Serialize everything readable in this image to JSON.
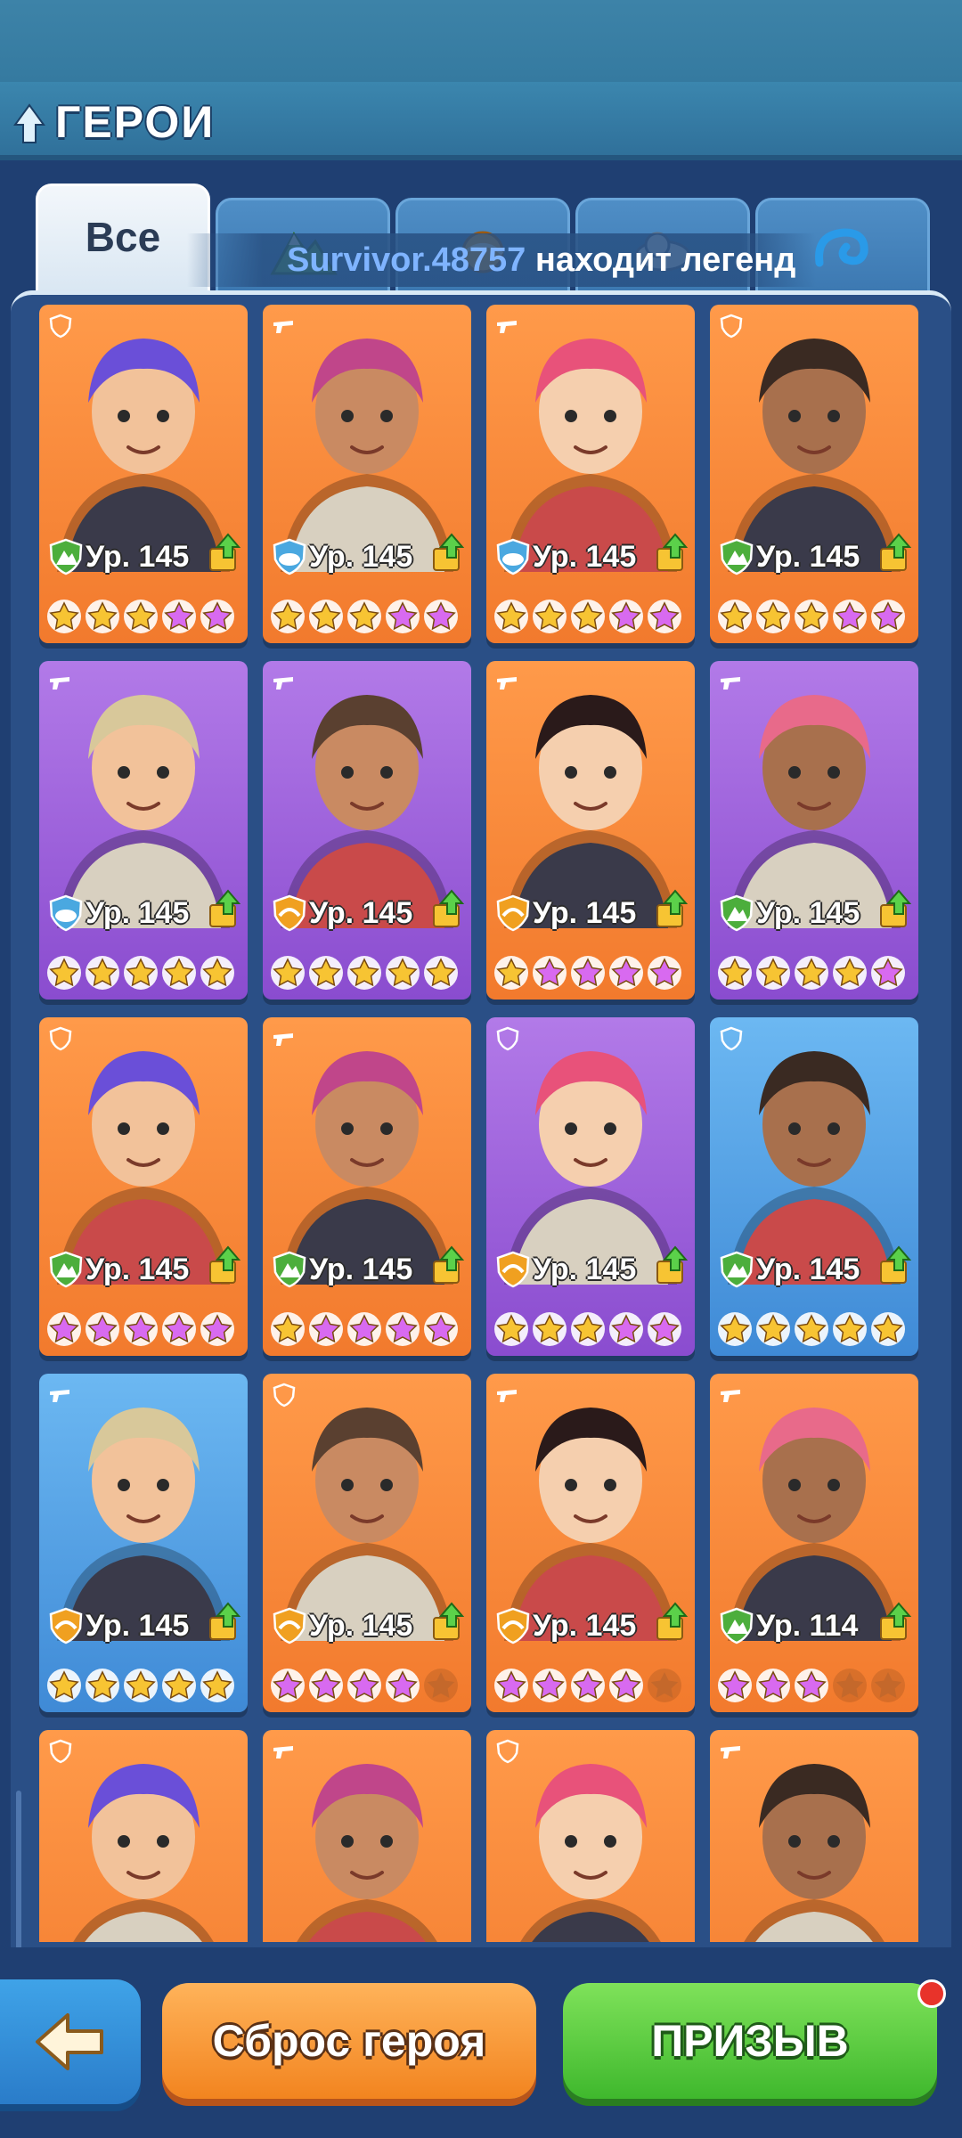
{
  "header": {
    "title": "ГЕРОИ"
  },
  "tabs": [
    {
      "label": "Все",
      "icon": "all",
      "active": true
    },
    {
      "label": "",
      "icon": "mountain-element-icon",
      "active": false
    },
    {
      "label": "",
      "icon": "sun-element-icon",
      "active": false
    },
    {
      "label": "",
      "icon": "cloud-element-icon",
      "active": false
    },
    {
      "label": "",
      "icon": "wave-element-icon",
      "active": false
    }
  ],
  "ticker": {
    "name": "Survivor.48757",
    "message": " находит легенд"
  },
  "heroes": [
    {
      "bg": "orange",
      "role": "shield-icon",
      "element": "mountain",
      "level": "Ур. 145",
      "gold": 3,
      "purple": 2
    },
    {
      "bg": "orange",
      "role": "gun-icon",
      "element": "cloud",
      "level": "Ур. 145",
      "gold": 3,
      "purple": 2
    },
    {
      "bg": "orange",
      "role": "gun-icon",
      "element": "cloud",
      "level": "Ур. 145",
      "gold": 3,
      "purple": 2
    },
    {
      "bg": "orange",
      "role": "shield-icon",
      "element": "mountain",
      "level": "Ур. 145",
      "gold": 3,
      "purple": 2
    },
    {
      "bg": "purple",
      "role": "gun-icon",
      "element": "cloud",
      "level": "Ур. 145",
      "gold": 5,
      "purple": 0
    },
    {
      "bg": "purple",
      "role": "gun-icon",
      "element": "sun",
      "level": "Ур. 145",
      "gold": 5,
      "purple": 0
    },
    {
      "bg": "orange",
      "role": "gun-icon",
      "element": "sun",
      "level": "Ур. 145",
      "gold": 1,
      "purple": 4
    },
    {
      "bg": "purple",
      "role": "gun-icon",
      "element": "mountain",
      "level": "Ур. 145",
      "gold": 4,
      "purple": 1
    },
    {
      "bg": "orange",
      "role": "shield-icon",
      "element": "mountain",
      "level": "Ур. 145",
      "gold": 0,
      "purple": 5
    },
    {
      "bg": "orange",
      "role": "gun-icon",
      "element": "mountain",
      "level": "Ур. 145",
      "gold": 1,
      "purple": 4
    },
    {
      "bg": "purple",
      "role": "shield-icon",
      "element": "sun",
      "level": "Ур. 145",
      "gold": 3,
      "purple": 2
    },
    {
      "bg": "blue",
      "role": "shield-icon",
      "element": "mountain",
      "level": "Ур. 145",
      "gold": 5,
      "purple": 0
    },
    {
      "bg": "blue",
      "role": "gun-icon",
      "element": "sun",
      "level": "Ур. 145",
      "gold": 5,
      "purple": 0
    },
    {
      "bg": "orange",
      "role": "shield-icon",
      "element": "sun",
      "level": "Ур. 145",
      "gold": 0,
      "purple": 4
    },
    {
      "bg": "orange",
      "role": "gun-icon",
      "element": "sun",
      "level": "Ур. 145",
      "gold": 0,
      "purple": 4
    },
    {
      "bg": "orange",
      "role": "gun-icon",
      "element": "mountain",
      "level": "Ур. 114",
      "gold": 0,
      "purple": 3
    },
    {
      "bg": "orange",
      "role": "shield-icon",
      "element": "",
      "level": "",
      "gold": 0,
      "purple": 0
    },
    {
      "bg": "orange",
      "role": "gun-icon",
      "element": "",
      "level": "",
      "gold": 0,
      "purple": 0
    },
    {
      "bg": "orange",
      "role": "shield-icon",
      "element": "",
      "level": "",
      "gold": 0,
      "purple": 0
    },
    {
      "bg": "orange",
      "role": "gun-icon",
      "element": "",
      "level": "",
      "gold": 0,
      "purple": 0
    }
  ],
  "footer": {
    "back_icon": "arrow-left-icon",
    "reset_label": "Сброс героя",
    "summon_label": "ПРИЗЫВ",
    "summon_has_notification": true
  },
  "colors": {
    "orange_card": "#f27a2d",
    "purple_card": "#8a4ccf",
    "blue_card": "#3f8ad6",
    "gold_star": "#f7c433",
    "purple_star": "#d86af0",
    "empty_star": "#c4682b"
  }
}
